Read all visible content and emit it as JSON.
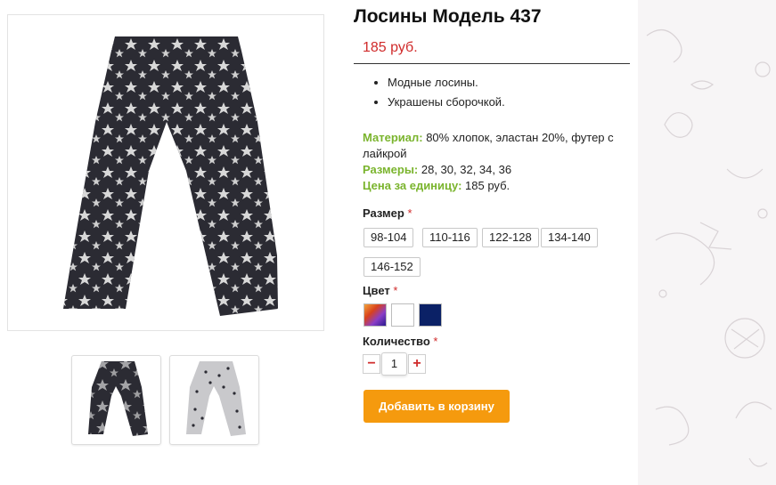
{
  "product": {
    "title": "Лосины Модель 437",
    "price": "185 руб.",
    "features": [
      "Модные лосины.",
      "Украшены сборочкой."
    ],
    "specs": {
      "material_label": "Материал:",
      "material_value": "80% хлопок, эластан 20%, футер с лайкрой",
      "sizes_label": "Размеры:",
      "sizes_value": "28, 30, 32, 34, 36",
      "unit_price_label": "Цена за единицу:",
      "unit_price_value": "185 руб."
    }
  },
  "options": {
    "size_label": "Размер",
    "sizes": [
      "98-104",
      "110-116",
      "122-128",
      "134-140",
      "146-152"
    ],
    "color_label": "Цвет",
    "colors": [
      {
        "name": "multicolor-gradient-swatch",
        "hex": "#8a3ec7"
      },
      {
        "name": "white-swatch",
        "hex": "#ffffff"
      },
      {
        "name": "navy-swatch",
        "hex": "#0b2166"
      }
    ],
    "quantity_label": "Количество",
    "required_mark": "*",
    "quantity": "1",
    "minus": "−",
    "plus": "+"
  },
  "actions": {
    "add_to_cart": "Добавить в корзину"
  },
  "images": {
    "main": "dark-leggings-with-stars",
    "thumbs": [
      "dark-leggings-thumb",
      "grey-leggings-thumb"
    ]
  }
}
